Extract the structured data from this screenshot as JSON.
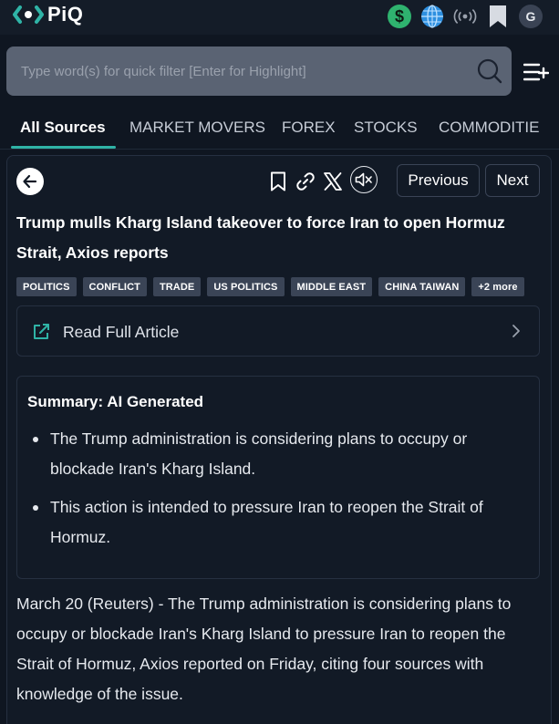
{
  "app": {
    "logo_text": "PiQ",
    "avatar_initial": "G"
  },
  "search": {
    "placeholder": "Type word(s) for quick filter [Enter for Highlight]"
  },
  "tabs": [
    {
      "label": "All Sources",
      "active": true
    },
    {
      "label": "MARKET MOVERS",
      "active": false
    },
    {
      "label": "FOREX",
      "active": false
    },
    {
      "label": "STOCKS",
      "active": false
    },
    {
      "label": "COMMODITIE",
      "active": false
    }
  ],
  "article": {
    "nav": {
      "previous_label": "Previous",
      "next_label": "Next"
    },
    "headline": "Trump mulls Kharg Island takeover to force Iran to open Hormuz Strait, Axios reports",
    "tags": [
      "POLITICS",
      "CONFLICT",
      "TRADE",
      "US POLITICS",
      "MIDDLE EAST",
      "CHINA TAIWAN",
      "+2 more"
    ],
    "read_full_label": "Read Full Article",
    "summary": {
      "title": "Summary: AI Generated",
      "bullets": [
        "The Trump administration is considering plans to occupy or blockade Iran's Kharg Island.",
        "This action is intended to pressure Iran to reopen the Strait of Hormuz."
      ]
    },
    "body": "March 20 (Reuters) - The Trump administration is considering plans to occupy or blockade Iran's Kharg Island to pressure Iran to reopen the Strait of Hormuz, Axios reported on Friday, citing four sources with knowledge of the issue."
  },
  "colors": {
    "background": "#0f1621",
    "accent": "#2fb3a6",
    "dollar_badge": "#2fb36f",
    "globe": "#2d8fe0",
    "tag_bg": "#3a4456"
  },
  "icons": [
    "dollar-icon",
    "globe-icon",
    "broadcast-icon",
    "bookmark-icon",
    "search-icon",
    "filter-menu-icon",
    "back-arrow-icon",
    "link-icon",
    "x-share-icon",
    "mute-icon",
    "external-link-icon",
    "chevron-right-icon"
  ]
}
